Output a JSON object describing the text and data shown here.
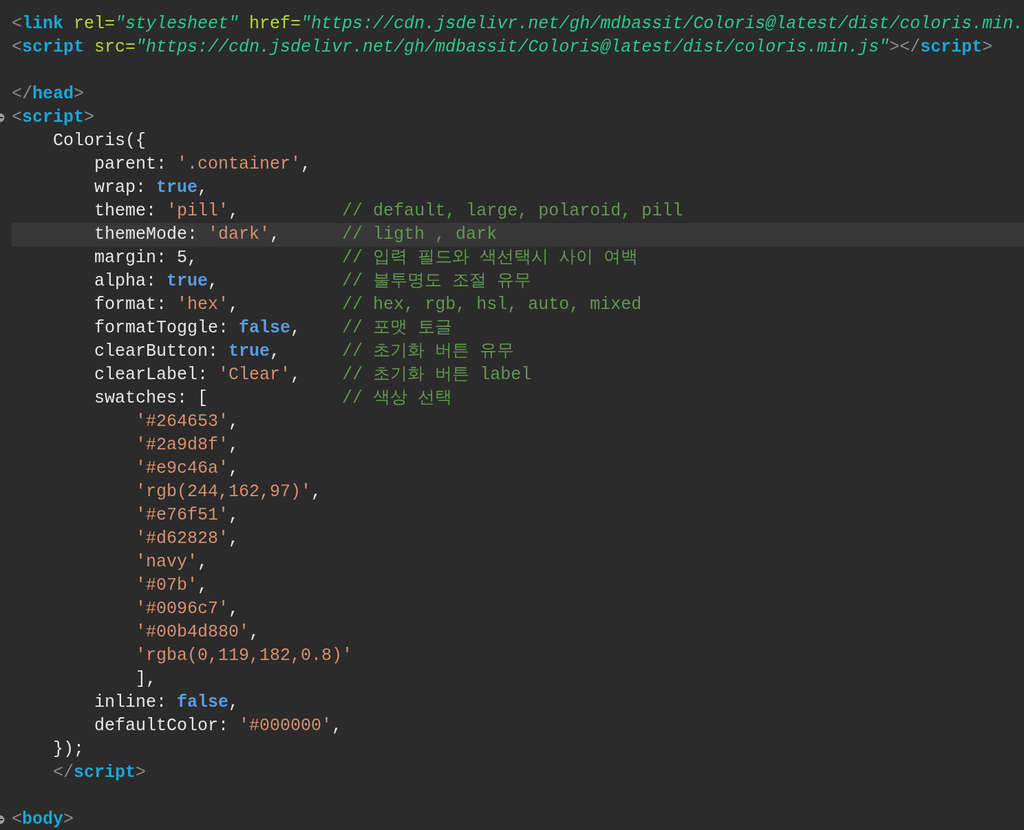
{
  "editor": {
    "lines": [
      {
        "fold": false,
        "current": false,
        "tokens": [
          {
            "kind": "punct",
            "text": "<"
          },
          {
            "kind": "tag",
            "text": "link"
          },
          {
            "kind": "attr",
            "text": " rel="
          },
          {
            "kind": "attrval",
            "text": "\"stylesheet\""
          },
          {
            "kind": "attr",
            "text": " href="
          },
          {
            "kind": "attrval",
            "text": "\"https://cdn.jsdelivr.net/gh/mdbassit/Coloris@latest/dist/coloris.min."
          }
        ]
      },
      {
        "fold": false,
        "current": false,
        "tokens": [
          {
            "kind": "punct",
            "text": "<"
          },
          {
            "kind": "tag",
            "text": "script"
          },
          {
            "kind": "attr",
            "text": " src="
          },
          {
            "kind": "attrval",
            "text": "\"https://cdn.jsdelivr.net/gh/mdbassit/Coloris@latest/dist/coloris.min.js\""
          },
          {
            "kind": "punct",
            "text": "></"
          },
          {
            "kind": "tag",
            "text": "script"
          },
          {
            "kind": "punct",
            "text": ">"
          }
        ]
      },
      {
        "fold": false,
        "current": false
      },
      {
        "fold": false,
        "current": false,
        "tokens": [
          {
            "kind": "punct",
            "text": "</"
          },
          {
            "kind": "tag",
            "text": "head"
          },
          {
            "kind": "punct",
            "text": ">"
          }
        ]
      },
      {
        "fold": true,
        "current": false,
        "tokens": [
          {
            "kind": "punct",
            "text": "<"
          },
          {
            "kind": "tag",
            "text": "script"
          },
          {
            "kind": "punct",
            "text": ">"
          }
        ]
      },
      {
        "fold": false,
        "current": false,
        "tokens": [
          {
            "kind": "text",
            "text": "    Coloris({"
          }
        ]
      },
      {
        "fold": false,
        "current": false,
        "tokens": [
          {
            "kind": "text",
            "text": "        parent: "
          },
          {
            "kind": "str",
            "text": "'.container'"
          },
          {
            "kind": "text",
            "text": ","
          }
        ]
      },
      {
        "fold": false,
        "current": false,
        "tokens": [
          {
            "kind": "text",
            "text": "        wrap: "
          },
          {
            "kind": "kw",
            "text": "true"
          },
          {
            "kind": "text",
            "text": ","
          }
        ]
      },
      {
        "fold": false,
        "current": false,
        "tokens": [
          {
            "kind": "text",
            "text": "        theme: "
          },
          {
            "kind": "str",
            "text": "'pill'"
          },
          {
            "kind": "text",
            "text": ","
          },
          {
            "kind": "comment",
            "text": "// default, large, polaroid, pill"
          }
        ]
      },
      {
        "fold": false,
        "current": true,
        "tokens": [
          {
            "kind": "text",
            "text": "        themeMode: "
          },
          {
            "kind": "str",
            "text": "'dark'"
          },
          {
            "kind": "text",
            "text": ","
          },
          {
            "kind": "comment",
            "text": "// ligth , dark"
          }
        ]
      },
      {
        "fold": false,
        "current": false,
        "tokens": [
          {
            "kind": "text",
            "text": "        margin: 5,"
          },
          {
            "kind": "comment",
            "text": "// 입력 필드와 색선택시 사이 여백"
          }
        ]
      },
      {
        "fold": false,
        "current": false,
        "tokens": [
          {
            "kind": "text",
            "text": "        alpha: "
          },
          {
            "kind": "kw",
            "text": "true"
          },
          {
            "kind": "text",
            "text": ","
          },
          {
            "kind": "comment",
            "text": "// 불투명도 조절 유무"
          }
        ]
      },
      {
        "fold": false,
        "current": false,
        "tokens": [
          {
            "kind": "text",
            "text": "        format: "
          },
          {
            "kind": "str",
            "text": "'hex'"
          },
          {
            "kind": "text",
            "text": ","
          },
          {
            "kind": "comment",
            "text": "// hex, rgb, hsl, auto, mixed"
          }
        ]
      },
      {
        "fold": false,
        "current": false,
        "tokens": [
          {
            "kind": "text",
            "text": "        formatToggle: "
          },
          {
            "kind": "kw",
            "text": "false"
          },
          {
            "kind": "text",
            "text": ","
          },
          {
            "kind": "comment",
            "text": "// 포맷 토글"
          }
        ]
      },
      {
        "fold": false,
        "current": false,
        "tokens": [
          {
            "kind": "text",
            "text": "        clearButton: "
          },
          {
            "kind": "kw",
            "text": "true"
          },
          {
            "kind": "text",
            "text": ","
          },
          {
            "kind": "comment",
            "text": "// 초기화 버튼 유무"
          }
        ]
      },
      {
        "fold": false,
        "current": false,
        "tokens": [
          {
            "kind": "text",
            "text": "        clearLabel: "
          },
          {
            "kind": "str",
            "text": "'Clear'"
          },
          {
            "kind": "text",
            "text": ","
          },
          {
            "kind": "comment",
            "text": "// 초기화 버튼 label"
          }
        ]
      },
      {
        "fold": false,
        "current": false,
        "tokens": [
          {
            "kind": "text",
            "text": "        swatches: ["
          },
          {
            "kind": "comment",
            "text": "// 색상 선택"
          }
        ]
      },
      {
        "fold": false,
        "current": false,
        "tokens": [
          {
            "kind": "str",
            "text": "            '#264653'"
          },
          {
            "kind": "text",
            "text": ","
          }
        ]
      },
      {
        "fold": false,
        "current": false,
        "tokens": [
          {
            "kind": "str",
            "text": "            '#2a9d8f'"
          },
          {
            "kind": "text",
            "text": ","
          }
        ]
      },
      {
        "fold": false,
        "current": false,
        "tokens": [
          {
            "kind": "str",
            "text": "            '#e9c46a'"
          },
          {
            "kind": "text",
            "text": ","
          }
        ]
      },
      {
        "fold": false,
        "current": false,
        "tokens": [
          {
            "kind": "str",
            "text": "            'rgb(244,162,97)'"
          },
          {
            "kind": "text",
            "text": ","
          }
        ]
      },
      {
        "fold": false,
        "current": false,
        "tokens": [
          {
            "kind": "str",
            "text": "            '#e76f51'"
          },
          {
            "kind": "text",
            "text": ","
          }
        ]
      },
      {
        "fold": false,
        "current": false,
        "tokens": [
          {
            "kind": "str",
            "text": "            '#d62828'"
          },
          {
            "kind": "text",
            "text": ","
          }
        ]
      },
      {
        "fold": false,
        "current": false,
        "tokens": [
          {
            "kind": "str",
            "text": "            'navy'"
          },
          {
            "kind": "text",
            "text": ","
          }
        ]
      },
      {
        "fold": false,
        "current": false,
        "tokens": [
          {
            "kind": "str",
            "text": "            '#07b'"
          },
          {
            "kind": "text",
            "text": ","
          }
        ]
      },
      {
        "fold": false,
        "current": false,
        "tokens": [
          {
            "kind": "str",
            "text": "            '#0096c7'"
          },
          {
            "kind": "text",
            "text": ","
          }
        ]
      },
      {
        "fold": false,
        "current": false,
        "tokens": [
          {
            "kind": "str",
            "text": "            '#00b4d880'"
          },
          {
            "kind": "text",
            "text": ","
          }
        ]
      },
      {
        "fold": false,
        "current": false,
        "tokens": [
          {
            "kind": "str",
            "text": "            'rgba(0,119,182,0.8)'"
          }
        ]
      },
      {
        "fold": false,
        "current": false,
        "tokens": [
          {
            "kind": "text",
            "text": "            ],"
          }
        ]
      },
      {
        "fold": false,
        "current": false,
        "tokens": [
          {
            "kind": "text",
            "text": "        inline: "
          },
          {
            "kind": "kw",
            "text": "false"
          },
          {
            "kind": "text",
            "text": ","
          }
        ]
      },
      {
        "fold": false,
        "current": false,
        "tokens": [
          {
            "kind": "text",
            "text": "        defaultColor: "
          },
          {
            "kind": "str",
            "text": "'#000000'"
          },
          {
            "kind": "text",
            "text": ","
          }
        ]
      },
      {
        "fold": false,
        "current": false,
        "tokens": [
          {
            "kind": "text",
            "text": "    });"
          }
        ]
      },
      {
        "fold": false,
        "current": false,
        "tokens": [
          {
            "kind": "punct",
            "text": "    </"
          },
          {
            "kind": "tag",
            "text": "script"
          },
          {
            "kind": "punct",
            "text": ">"
          }
        ]
      },
      {
        "fold": false,
        "current": false
      },
      {
        "fold": true,
        "current": false,
        "tokens": [
          {
            "kind": "punct",
            "text": "<"
          },
          {
            "kind": "tag",
            "text": "body"
          },
          {
            "kind": "punct",
            "text": ">"
          }
        ]
      }
    ]
  }
}
